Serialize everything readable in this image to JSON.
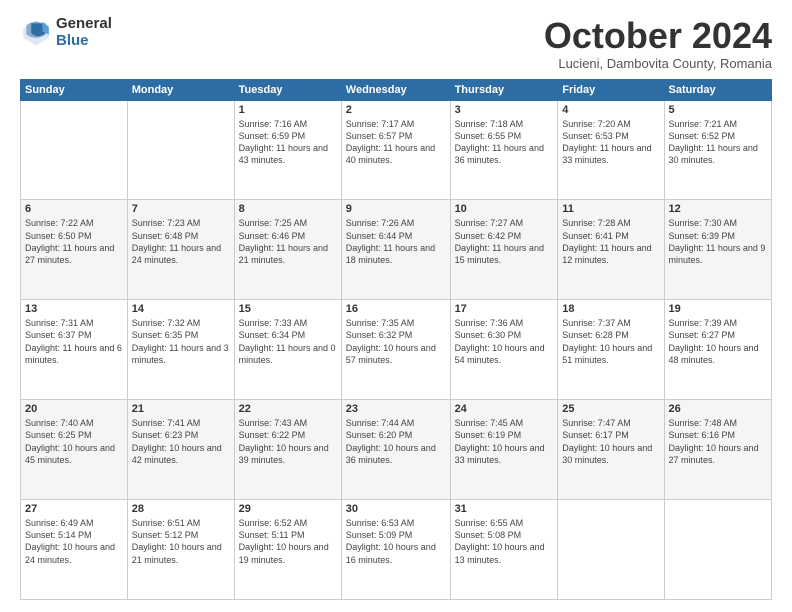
{
  "logo": {
    "general": "General",
    "blue": "Blue"
  },
  "header": {
    "month": "October 2024",
    "location": "Lucieni, Dambovita County, Romania"
  },
  "weekdays": [
    "Sunday",
    "Monday",
    "Tuesday",
    "Wednesday",
    "Thursday",
    "Friday",
    "Saturday"
  ],
  "weeks": [
    [
      {
        "day": "",
        "content": ""
      },
      {
        "day": "",
        "content": ""
      },
      {
        "day": "1",
        "content": "Sunrise: 7:16 AM\nSunset: 6:59 PM\nDaylight: 11 hours and 43 minutes."
      },
      {
        "day": "2",
        "content": "Sunrise: 7:17 AM\nSunset: 6:57 PM\nDaylight: 11 hours and 40 minutes."
      },
      {
        "day": "3",
        "content": "Sunrise: 7:18 AM\nSunset: 6:55 PM\nDaylight: 11 hours and 36 minutes."
      },
      {
        "day": "4",
        "content": "Sunrise: 7:20 AM\nSunset: 6:53 PM\nDaylight: 11 hours and 33 minutes."
      },
      {
        "day": "5",
        "content": "Sunrise: 7:21 AM\nSunset: 6:52 PM\nDaylight: 11 hours and 30 minutes."
      }
    ],
    [
      {
        "day": "6",
        "content": "Sunrise: 7:22 AM\nSunset: 6:50 PM\nDaylight: 11 hours and 27 minutes."
      },
      {
        "day": "7",
        "content": "Sunrise: 7:23 AM\nSunset: 6:48 PM\nDaylight: 11 hours and 24 minutes."
      },
      {
        "day": "8",
        "content": "Sunrise: 7:25 AM\nSunset: 6:46 PM\nDaylight: 11 hours and 21 minutes."
      },
      {
        "day": "9",
        "content": "Sunrise: 7:26 AM\nSunset: 6:44 PM\nDaylight: 11 hours and 18 minutes."
      },
      {
        "day": "10",
        "content": "Sunrise: 7:27 AM\nSunset: 6:42 PM\nDaylight: 11 hours and 15 minutes."
      },
      {
        "day": "11",
        "content": "Sunrise: 7:28 AM\nSunset: 6:41 PM\nDaylight: 11 hours and 12 minutes."
      },
      {
        "day": "12",
        "content": "Sunrise: 7:30 AM\nSunset: 6:39 PM\nDaylight: 11 hours and 9 minutes."
      }
    ],
    [
      {
        "day": "13",
        "content": "Sunrise: 7:31 AM\nSunset: 6:37 PM\nDaylight: 11 hours and 6 minutes."
      },
      {
        "day": "14",
        "content": "Sunrise: 7:32 AM\nSunset: 6:35 PM\nDaylight: 11 hours and 3 minutes."
      },
      {
        "day": "15",
        "content": "Sunrise: 7:33 AM\nSunset: 6:34 PM\nDaylight: 11 hours and 0 minutes."
      },
      {
        "day": "16",
        "content": "Sunrise: 7:35 AM\nSunset: 6:32 PM\nDaylight: 10 hours and 57 minutes."
      },
      {
        "day": "17",
        "content": "Sunrise: 7:36 AM\nSunset: 6:30 PM\nDaylight: 10 hours and 54 minutes."
      },
      {
        "day": "18",
        "content": "Sunrise: 7:37 AM\nSunset: 6:28 PM\nDaylight: 10 hours and 51 minutes."
      },
      {
        "day": "19",
        "content": "Sunrise: 7:39 AM\nSunset: 6:27 PM\nDaylight: 10 hours and 48 minutes."
      }
    ],
    [
      {
        "day": "20",
        "content": "Sunrise: 7:40 AM\nSunset: 6:25 PM\nDaylight: 10 hours and 45 minutes."
      },
      {
        "day": "21",
        "content": "Sunrise: 7:41 AM\nSunset: 6:23 PM\nDaylight: 10 hours and 42 minutes."
      },
      {
        "day": "22",
        "content": "Sunrise: 7:43 AM\nSunset: 6:22 PM\nDaylight: 10 hours and 39 minutes."
      },
      {
        "day": "23",
        "content": "Sunrise: 7:44 AM\nSunset: 6:20 PM\nDaylight: 10 hours and 36 minutes."
      },
      {
        "day": "24",
        "content": "Sunrise: 7:45 AM\nSunset: 6:19 PM\nDaylight: 10 hours and 33 minutes."
      },
      {
        "day": "25",
        "content": "Sunrise: 7:47 AM\nSunset: 6:17 PM\nDaylight: 10 hours and 30 minutes."
      },
      {
        "day": "26",
        "content": "Sunrise: 7:48 AM\nSunset: 6:16 PM\nDaylight: 10 hours and 27 minutes."
      }
    ],
    [
      {
        "day": "27",
        "content": "Sunrise: 6:49 AM\nSunset: 5:14 PM\nDaylight: 10 hours and 24 minutes."
      },
      {
        "day": "28",
        "content": "Sunrise: 6:51 AM\nSunset: 5:12 PM\nDaylight: 10 hours and 21 minutes."
      },
      {
        "day": "29",
        "content": "Sunrise: 6:52 AM\nSunset: 5:11 PM\nDaylight: 10 hours and 19 minutes."
      },
      {
        "day": "30",
        "content": "Sunrise: 6:53 AM\nSunset: 5:09 PM\nDaylight: 10 hours and 16 minutes."
      },
      {
        "day": "31",
        "content": "Sunrise: 6:55 AM\nSunset: 5:08 PM\nDaylight: 10 hours and 13 minutes."
      },
      {
        "day": "",
        "content": ""
      },
      {
        "day": "",
        "content": ""
      }
    ]
  ]
}
